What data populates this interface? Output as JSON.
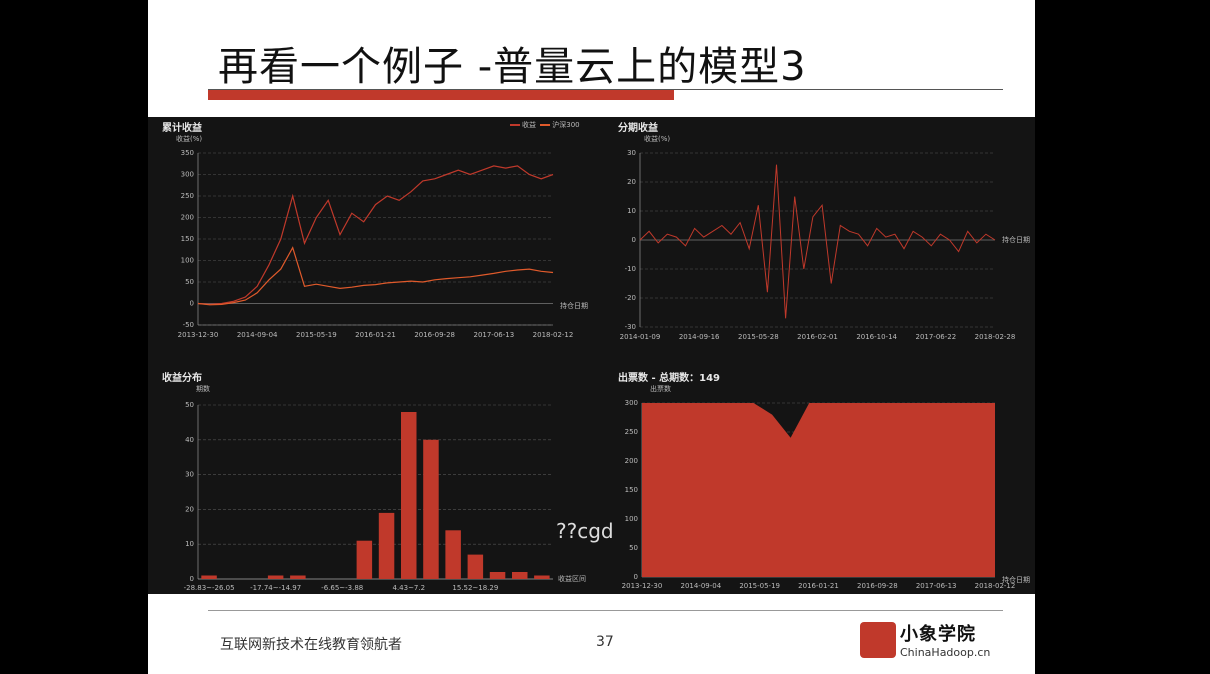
{
  "slide": {
    "title": "再看一个例子 -普量云上的模型3",
    "footer_text": "互联网新技术在线教育领航者",
    "page_number": "37",
    "logo_cn": "小象学院",
    "logo_en": "ChinaHadoop.cn",
    "overlay_text": "??cgd",
    "accent": "#c0392b",
    "line_color": "#e05a2b"
  },
  "chart_data": [
    {
      "type": "line",
      "title": "累计收益",
      "ylabel": "收益(%)",
      "xlabel": "持仓日期",
      "legend": [
        "收益",
        "沪深300"
      ],
      "legend_position": "top-right",
      "ylim": [
        -50,
        350
      ],
      "yticks": [
        -50,
        0,
        50,
        100,
        150,
        200,
        250,
        300,
        350
      ],
      "xticks": [
        "2013-12-30",
        "2014-09-04",
        "2015-05-19",
        "2016-01-21",
        "2016-09-28",
        "2017-06-13",
        "2018-02-12"
      ],
      "x": [
        0,
        1,
        2,
        3,
        4,
        5,
        6,
        7,
        8,
        9,
        10,
        11,
        12,
        13,
        14,
        15,
        16,
        17,
        18,
        19,
        20,
        21,
        22,
        23,
        24,
        25,
        26,
        27,
        28,
        29,
        30
      ],
      "series": [
        {
          "name": "收益",
          "values": [
            0,
            -2,
            0,
            5,
            15,
            40,
            90,
            150,
            250,
            140,
            200,
            240,
            160,
            210,
            190,
            230,
            250,
            240,
            260,
            285,
            290,
            300,
            310,
            300,
            310,
            320,
            315,
            320,
            300,
            290,
            300
          ]
        },
        {
          "name": "沪深300",
          "values": [
            0,
            -3,
            -2,
            2,
            8,
            25,
            55,
            80,
            130,
            40,
            45,
            40,
            35,
            38,
            42,
            44,
            48,
            50,
            52,
            50,
            55,
            58,
            60,
            62,
            66,
            70,
            75,
            78,
            80,
            75,
            72
          ]
        }
      ],
      "grid": true
    },
    {
      "type": "line",
      "title": "分期收益",
      "ylabel": "收益(%)",
      "xlabel": "持仓日期",
      "ylim": [
        -30,
        30
      ],
      "yticks": [
        -30,
        -20,
        -10,
        0,
        10,
        20,
        30
      ],
      "xticks": [
        "2014-01-09",
        "2014-09-16",
        "2015-05-28",
        "2016-02-01",
        "2016-10-14",
        "2017-06-22",
        "2018-02-28"
      ],
      "series": [
        {
          "name": "",
          "values": [
            0,
            3,
            -1,
            2,
            1,
            -2,
            4,
            1,
            3,
            5,
            2,
            6,
            -3,
            12,
            -18,
            26,
            -27,
            15,
            -10,
            8,
            12,
            -15,
            5,
            3,
            2,
            -2,
            4,
            1,
            2,
            -3,
            3,
            1,
            -2,
            2,
            0,
            -4,
            3,
            -1,
            2,
            0
          ]
        }
      ],
      "grid": true
    },
    {
      "type": "bar",
      "title": "收益分布",
      "ylabel": "期数",
      "xlabel": "收益区间",
      "ylim": [
        0,
        50
      ],
      "yticks": [
        0,
        10,
        20,
        30,
        40,
        50
      ],
      "categories": [
        "-28.83~-26.05",
        "",
        "",
        "-17.74~-14.97",
        "",
        "",
        "-6.65~-3.88",
        "",
        "",
        "4.43~7.2",
        "",
        "",
        "15.52~18.29",
        "",
        ""
      ],
      "values": [
        1,
        0,
        0,
        1,
        1,
        0,
        0,
        11,
        19,
        48,
        40,
        14,
        7,
        2,
        2,
        1
      ],
      "grid": true
    },
    {
      "type": "area",
      "title": "出票数 - 总期数：149",
      "ylabel": "出票数",
      "xlabel": "持仓日期",
      "ylim": [
        0,
        300
      ],
      "yticks": [
        0,
        50,
        100,
        150,
        200,
        250,
        300
      ],
      "xticks": [
        "2013-12-30",
        "2014-09-04",
        "2015-05-19",
        "2016-01-21",
        "2016-09-28",
        "2017-06-13",
        "2018-02-12"
      ],
      "values": [
        300,
        300,
        300,
        300,
        300,
        300,
        300,
        280,
        240,
        300,
        300,
        300,
        300,
        300,
        300,
        300,
        300,
        300,
        300,
        300
      ],
      "grid": true
    }
  ]
}
